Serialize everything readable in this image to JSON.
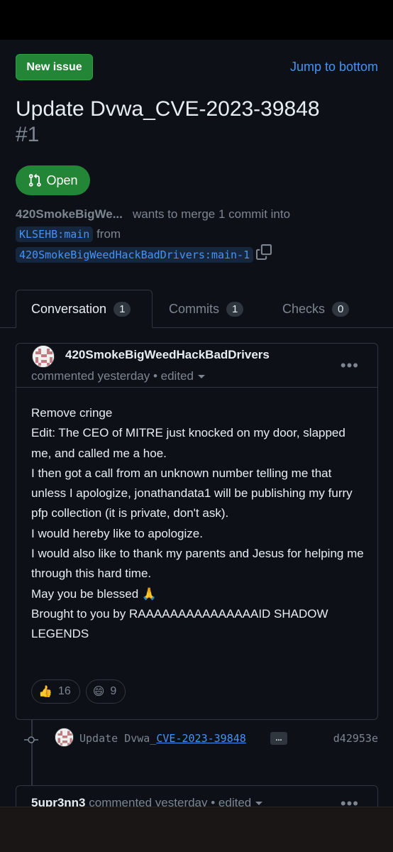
{
  "header": {
    "new_issue_label": "New issue",
    "jump_label": "Jump to bottom"
  },
  "pr": {
    "title": "Update Dvwa_CVE-2023-39848",
    "number": "#1",
    "state": "Open",
    "author_short": "420SmokeBigWe...",
    "merge_text": "wants to merge 1 commit into",
    "base_branch": "KLSEHB:main",
    "from_text": "from",
    "head_branch": "420SmokeBigWeedHackBadDrivers:main-1"
  },
  "tabs": [
    {
      "label": "Conversation",
      "count": "1"
    },
    {
      "label": "Commits",
      "count": "1"
    },
    {
      "label": "Checks",
      "count": "0"
    }
  ],
  "comment": {
    "author": "420SmokeBigWeedHackBadDrivers",
    "meta": "commented yesterday • edited",
    "lines": [
      "Remove cringe",
      "Edit: The CEO of MITRE just knocked on my door, slapped me, and called me a hoe.",
      "I then got a call from an unknown number telling me that unless I apologize, jonathandata1 will be publishing my furry pfp collection (it is private, don't ask).",
      "I would hereby like to apologize.",
      "I would also like to thank my parents and Jesus for helping me through this hard time.",
      "May you be blessed 🙏",
      "Brought to you by RAAAAAAAAAAAAAAAID SHADOW LEGENDS"
    ],
    "reactions": [
      {
        "emoji": "👍",
        "count": "16"
      },
      {
        "emoji": "😄",
        "count": "9"
      }
    ]
  },
  "commit": {
    "msg_prefix": "Update Dvwa_",
    "msg_link": "CVE-2023-39848",
    "ellipsis": "...",
    "sha": "d42953e"
  },
  "comment2": {
    "author": "5upr3nn3",
    "meta": "commented yesterday • edited"
  },
  "colors": {
    "bg": "#0d1117",
    "accent_green": "#238636",
    "link_blue": "#4493f8",
    "muted": "#7d8590",
    "border": "#30363d"
  }
}
